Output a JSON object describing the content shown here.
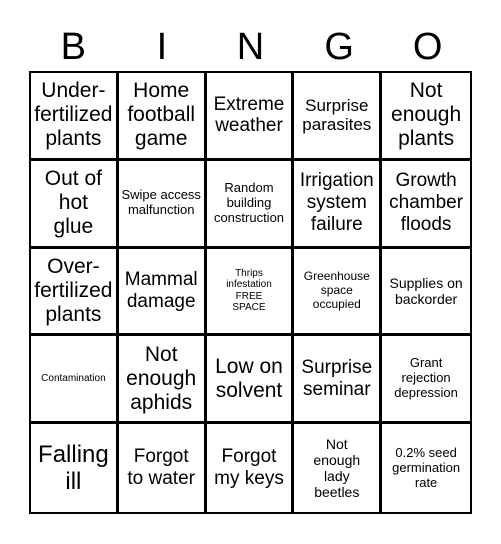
{
  "card": {
    "header_letters": [
      "B",
      "I",
      "N",
      "G",
      "O"
    ],
    "cells": [
      [
        "Under-fertilized plants",
        "Home football game",
        "Extreme weather",
        "Surprise parasites",
        "Not enough plants"
      ],
      [
        "Out of hot glue",
        "Swipe access malfunction",
        "Random building construction",
        "Irrigation system failure",
        "Growth chamber floods"
      ],
      [
        "Over-fertilized plants",
        "Mammal damage",
        "Thrips infestation FREE SPACE",
        "Greenhouse space occupied",
        "Supplies on backorder"
      ],
      [
        "Contamination",
        "Not enough aphids",
        "Low on solvent",
        "Surprise seminar",
        "Grant rejection depression"
      ],
      [
        "Falling ill",
        "Forgot to water",
        "Forgot my keys",
        "Not enough lady beetles",
        "0.2% seed germination rate"
      ]
    ],
    "free_space_cell": "Thrips infestation FREE SPACE",
    "colors": {
      "border": "#000000",
      "background": "#ffffff",
      "text": "#000000"
    }
  }
}
